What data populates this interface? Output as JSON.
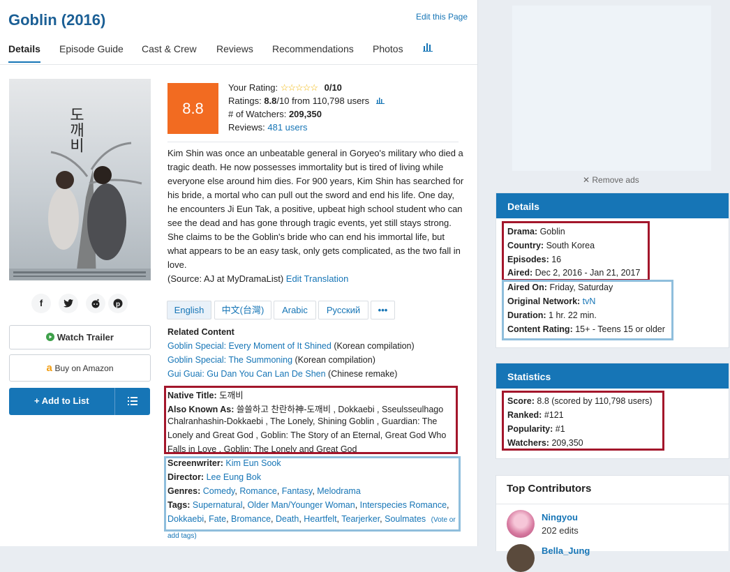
{
  "header": {
    "title": "Goblin (2016)",
    "edit_link": "Edit this Page"
  },
  "tabs": [
    "Details",
    "Episode Guide",
    "Cast & Crew",
    "Reviews",
    "Recommendations",
    "Photos"
  ],
  "stats_tab_icon": "bar-chart-icon",
  "poster": {
    "title_hanja": "도깨비"
  },
  "share_icons": [
    "facebook-icon",
    "twitter-icon",
    "reddit-icon",
    "pinterest-icon"
  ],
  "share_glyphs": [
    "f",
    "🐦",
    "●",
    "℗"
  ],
  "buttons": {
    "watch_trailer": "Watch Trailer",
    "buy_amazon": "Buy on Amazon",
    "add_to_list": "+ Add to List"
  },
  "rating": {
    "score": "8.8",
    "your_rating_label": "Your Rating:",
    "your_rating_value": "0/10",
    "ratings_label": "Ratings:",
    "ratings_value": "8.8",
    "ratings_rest": "/10 from 110,798 users",
    "watchers_label": "# of Watchers:",
    "watchers_value": "209,350",
    "reviews_label": "Reviews:",
    "reviews_link": "481 users"
  },
  "synopsis": "Kim Shin was once an unbeatable general in Goryeo's military who died a tragic death. He now possesses immortality but is tired of living while everyone else around him dies. For 900 years, Kim Shin has searched for his bride, a mortal who can pull out the sword and end his life. One day, he encounters Ji Eun Tak, a positive, upbeat high school student who can see the dead and has gone through tragic events, yet still stays strong. She claims to be the Goblin's bride who can end his immortal life, but what appears to be an easy task, only gets complicated, as the two fall in love.",
  "source": {
    "text": "(Source: AJ at MyDramaList)",
    "link": "Edit Translation"
  },
  "languages": [
    "English",
    "中文(台灣)",
    "Arabic",
    "Русский",
    "•••"
  ],
  "related": {
    "heading": "Related Content",
    "items": [
      {
        "link": "Goblin Special: Every Moment of It Shined",
        "note": "(Korean compilation)"
      },
      {
        "link": "Goblin Special: The Summoning",
        "note": "(Korean compilation)"
      },
      {
        "link": "Gui Guai: Gu Dan You Can Lan De Shen",
        "note": "(Chinese remake)"
      }
    ]
  },
  "titles": {
    "native_label": "Native Title:",
    "native_value": "도깨비",
    "aka_label": "Also Known As:",
    "aka_lines": [
      "쓸쓸하고 찬란하神-도깨비 , Dokkaebi , Sseulsseulhago",
      "Chalranhashin-Dokkaebi , The Lonely, Shining Goblin , Guardian: The",
      "Lonely and Great God , Goblin: The Story of an Eternal, Great God Who",
      "Falls in Love , Goblin: The Lonely and Great God"
    ]
  },
  "credits": {
    "screenwriter_label": "Screenwriter:",
    "screenwriter": "Kim Eun Sook",
    "director_label": "Director:",
    "director": "Lee Eung Bok",
    "genres_label": "Genres:",
    "genres": [
      "Comedy",
      "Romance",
      "Fantasy",
      "Melodrama"
    ],
    "tags_label": "Tags:",
    "tags_line1": [
      "Supernatural",
      "Older Man/Younger Woman",
      "Interspecies Romance"
    ],
    "tags_line2": [
      "Dokkaebi",
      "Fate",
      "Bromance",
      "Death",
      "Heartfelt",
      "Tearjerker",
      "Soulmates"
    ],
    "vote_a": "(Vote or",
    "vote_b": "add tags)"
  },
  "sidebar": {
    "remove_ads": "✕ Remove ads",
    "details": {
      "heading": "Details",
      "rows": [
        {
          "label": "Drama:",
          "value": "Goblin"
        },
        {
          "label": "Country:",
          "value": "South Korea"
        },
        {
          "label": "Episodes:",
          "value": "16"
        },
        {
          "label": "Aired:",
          "value": "Dec 2, 2016 - Jan 21, 2017"
        },
        {
          "label": "Aired On:",
          "value": "Friday, Saturday"
        },
        {
          "label": "Original Network:",
          "value": "tvN"
        },
        {
          "label": "Duration:",
          "value": "1 hr. 22 min."
        },
        {
          "label": "Content Rating:",
          "value": "15+ - Teens 15 or older"
        }
      ]
    },
    "statistics": {
      "heading": "Statistics",
      "rows": [
        {
          "label": "Score:",
          "value": "8.8 (scored by 110,798 users)"
        },
        {
          "label": "Ranked:",
          "value": "#121"
        },
        {
          "label": "Popularity:",
          "value": "#1"
        },
        {
          "label": "Watchers:",
          "value": "209,350"
        }
      ]
    },
    "contributors": {
      "heading": "Top Contributors",
      "items": [
        {
          "name": "Ningyou",
          "edits": "202 edits"
        },
        {
          "name": "Bella_Jung",
          "edits": ""
        }
      ]
    }
  },
  "colors": {
    "accent": "#1675b6",
    "score_orange": "#f26b21",
    "highlight_red": "#a3162b",
    "highlight_blue": "#8fbedc"
  }
}
